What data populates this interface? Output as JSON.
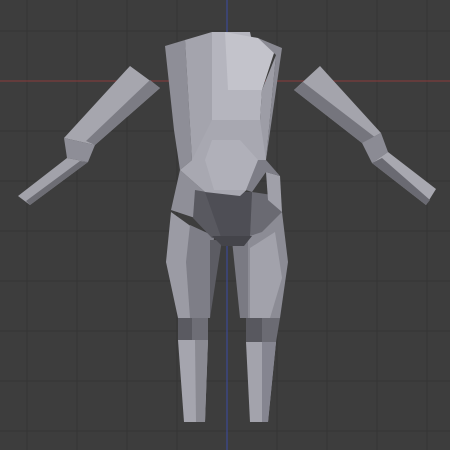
{
  "viewport": {
    "name": "3d-viewport",
    "background_color": "#3d3d3d",
    "grid": {
      "visible": true,
      "line_color": "#353535",
      "minor_line_color": "#383838"
    },
    "axes": {
      "x_axis_color": "#8a3b3b",
      "y_axis_color": "#3a4aa2"
    }
  },
  "model": {
    "name": "lowpoly-humanoid-base-mesh",
    "shading": "solid",
    "base_color": "#9a9aa3",
    "light_color": "#c4c4cc",
    "mid_color": "#8d8d96",
    "shadow_color": "#5d5d64",
    "dark_color": "#4a4a50",
    "parts": [
      "torso",
      "hips",
      "left-arm",
      "right-arm",
      "left-leg",
      "right-leg"
    ]
  }
}
